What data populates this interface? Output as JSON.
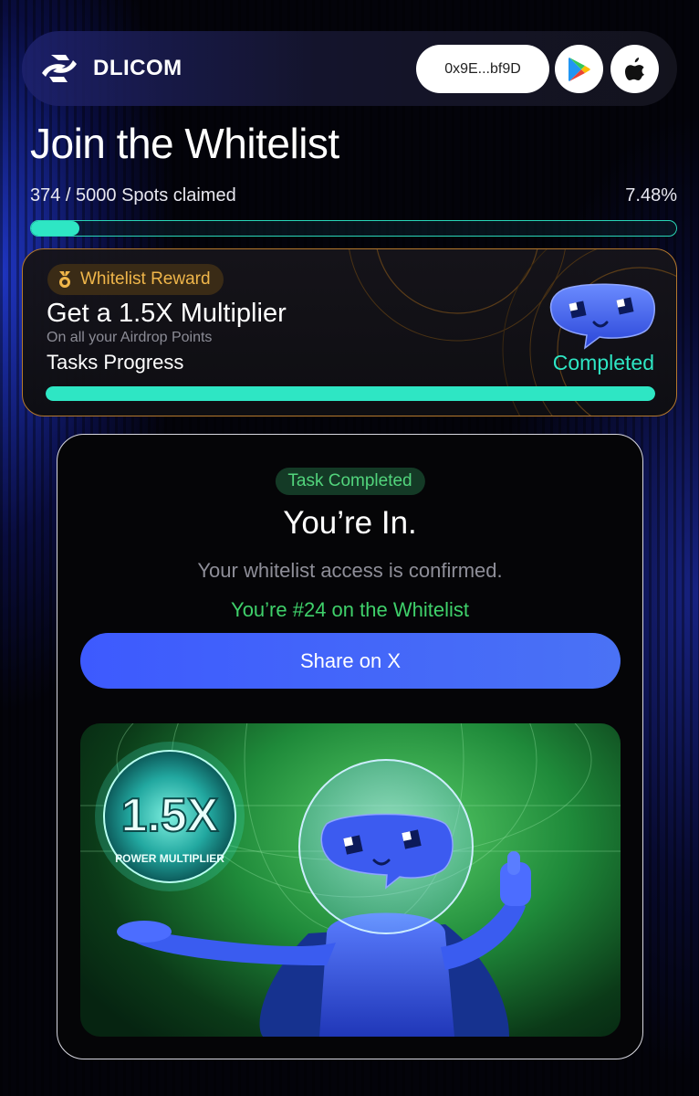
{
  "header": {
    "brand": "DLICOM",
    "wallet_address": "0x9E...bf9D",
    "play_store_icon": "google-play-icon",
    "app_store_icon": "apple-icon"
  },
  "page": {
    "title": "Join the Whitelist",
    "spots_claimed_text": "374 / 5000 Spots claimed",
    "spots_percent_text": "7.48%",
    "spots_claimed": 374,
    "spots_total": 5000,
    "progress_fraction": 0.0748,
    "accent_color": "#2ee6c4"
  },
  "reward": {
    "badge": "Whitelist Reward",
    "title": "Get a 1.5X Multiplier",
    "subtitle": "On all your Airdrop Points",
    "tasks_label": "Tasks Progress",
    "status": "Completed",
    "tasks_progress_fraction": 1.0
  },
  "result": {
    "chip": "Task Completed",
    "heading": "You’re In.",
    "message": "Your whitelist access is confirmed.",
    "rank_text": "You’re #24 on the Whitelist",
    "share_label": "Share on X"
  },
  "banner": {
    "orb_value": "1.5X",
    "orb_caption": "POWER MULTIPLIER"
  }
}
